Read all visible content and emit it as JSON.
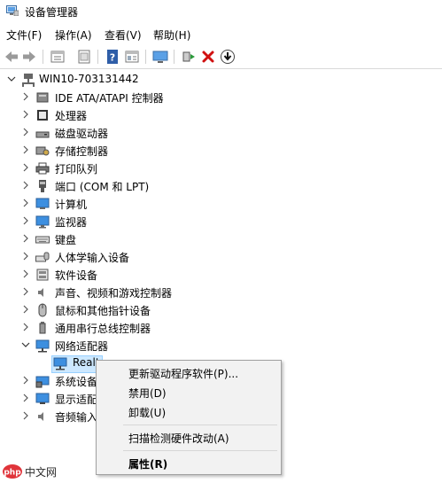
{
  "window": {
    "title": "设备管理器"
  },
  "menubar": [
    {
      "label": "文件(F)"
    },
    {
      "label": "操作(A)"
    },
    {
      "label": "查看(V)"
    },
    {
      "label": "帮助(H)"
    }
  ],
  "toolbar": [
    {
      "icon": "back-arrow-icon"
    },
    {
      "icon": "forward-arrow-icon"
    },
    {
      "icon": "properties-window-icon"
    },
    {
      "icon": "show-hidden-icon"
    },
    {
      "icon": "help-icon"
    },
    {
      "icon": "console-tree-icon"
    },
    {
      "icon": "scan-monitor-icon"
    },
    {
      "icon": "update-driver-icon"
    },
    {
      "icon": "uninstall-x-icon"
    },
    {
      "icon": "download-driver-icon"
    }
  ],
  "tree": {
    "root": {
      "label": "WIN10-703131442",
      "icon": "computer-network-icon",
      "expanded": true
    },
    "items": [
      {
        "label": "IDE ATA/ATAPI 控制器",
        "icon": "ide-controller-icon",
        "expanded": false
      },
      {
        "label": "处理器",
        "icon": "processor-icon",
        "expanded": false
      },
      {
        "label": "磁盘驱动器",
        "icon": "disk-drive-icon",
        "expanded": false
      },
      {
        "label": "存储控制器",
        "icon": "storage-controller-icon",
        "expanded": false
      },
      {
        "label": "打印队列",
        "icon": "printer-icon",
        "expanded": false
      },
      {
        "label": "端口 (COM 和 LPT)",
        "icon": "port-icon",
        "expanded": false
      },
      {
        "label": "计算机",
        "icon": "computer-icon",
        "expanded": false
      },
      {
        "label": "监视器",
        "icon": "monitor-icon",
        "expanded": false
      },
      {
        "label": "键盘",
        "icon": "keyboard-icon",
        "expanded": false
      },
      {
        "label": "人体学输入设备",
        "icon": "hid-icon",
        "expanded": false
      },
      {
        "label": "软件设备",
        "icon": "software-device-icon",
        "expanded": false
      },
      {
        "label": "声音、视频和游戏控制器",
        "icon": "sound-icon",
        "expanded": false
      },
      {
        "label": "鼠标和其他指针设备",
        "icon": "mouse-icon",
        "expanded": false
      },
      {
        "label": "通用串行总线控制器",
        "icon": "usb-icon",
        "expanded": false
      },
      {
        "label": "网络适配器",
        "icon": "network-adapter-icon",
        "expanded": true
      },
      {
        "label": "Realt",
        "icon": "network-adapter-icon",
        "child": true,
        "selected": true
      },
      {
        "label": "系统设备",
        "icon": "system-device-icon",
        "expanded": false
      },
      {
        "label": "显示适配",
        "icon": "display-adapter-icon",
        "expanded": false
      },
      {
        "label": "音频输入",
        "icon": "audio-input-icon",
        "expanded": false
      }
    ]
  },
  "context_menu": {
    "items": [
      {
        "label": "更新驱动程序软件(P)...",
        "bold": false
      },
      {
        "label": "禁用(D)",
        "bold": false
      },
      {
        "label": "卸载(U)",
        "bold": false
      },
      {
        "separator": true
      },
      {
        "label": "扫描检测硬件改动(A)",
        "bold": false
      },
      {
        "separator": true
      },
      {
        "label": "属性(R)",
        "bold": true
      }
    ]
  },
  "watermark": {
    "text": "中文网"
  },
  "colors": {
    "selection": "#cce8ff",
    "selection_border": "#99d1ff",
    "menu_bg": "#f2f2f2"
  }
}
